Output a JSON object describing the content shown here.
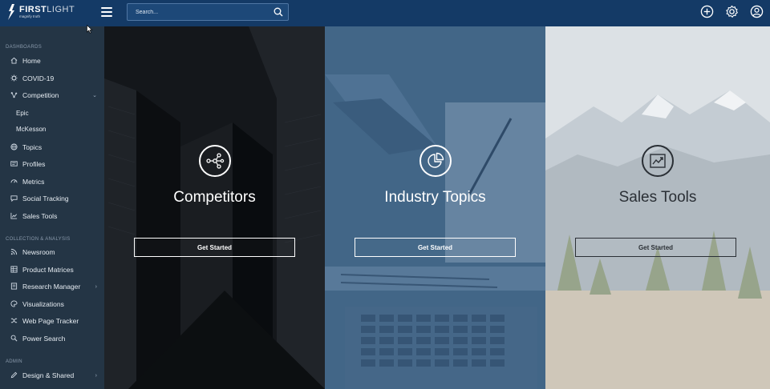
{
  "header": {
    "brand_name_bold": "FIRST",
    "brand_name_light": "LIGHT",
    "brand_tagline": "magnify truth",
    "search_placeholder": "Search..."
  },
  "icons": {
    "menu": "hamburger-icon",
    "search": "search-icon",
    "add": "plus-circle-icon",
    "settings": "gear-icon",
    "account": "user-circle-icon"
  },
  "sidebar": {
    "sections": [
      {
        "title": "DASHBOARDS",
        "items": [
          {
            "label": "Home",
            "icon": "home-icon"
          },
          {
            "label": "COVID-19",
            "icon": "virus-icon"
          },
          {
            "label": "Competition",
            "icon": "network-icon",
            "expanded": true,
            "children": [
              {
                "label": "Epic"
              },
              {
                "label": "McKesson"
              }
            ]
          },
          {
            "label": "Topics",
            "icon": "globe-icon"
          },
          {
            "label": "Profiles",
            "icon": "id-card-icon"
          },
          {
            "label": "Metrics",
            "icon": "gauge-icon"
          },
          {
            "label": "Social Tracking",
            "icon": "chat-icon"
          },
          {
            "label": "Sales Tools",
            "icon": "chart-line-icon"
          }
        ]
      },
      {
        "title": "COLLECTION & ANALYSIS",
        "items": [
          {
            "label": "Newsroom",
            "icon": "rss-icon"
          },
          {
            "label": "Product Matrices",
            "icon": "grid-icon"
          },
          {
            "label": "Research Manager",
            "icon": "book-icon"
          },
          {
            "label": "Visualizations",
            "icon": "palette-icon"
          },
          {
            "label": "Web Page Tracker",
            "icon": "shuffle-icon"
          },
          {
            "label": "Power Search",
            "icon": "magnify-icon"
          }
        ]
      },
      {
        "title": "ADMIN",
        "items": [
          {
            "label": "Design & Shared",
            "icon": "pencil-icon"
          }
        ]
      }
    ]
  },
  "panels": [
    {
      "title": "Competitors",
      "button": "Get Started",
      "icon": "network-nodes-icon"
    },
    {
      "title": "Industry Topics",
      "button": "Get Started",
      "icon": "pie-chart-icon"
    },
    {
      "title": "Sales Tools",
      "button": "Get Started",
      "icon": "trend-chart-icon"
    }
  ],
  "colors": {
    "topbar": "#143a66",
    "sidebar": "#243545",
    "panel_competitors": "#1c2026",
    "panel_topics": "#4a6c8c",
    "panel_sales": "#c7cdd2"
  }
}
